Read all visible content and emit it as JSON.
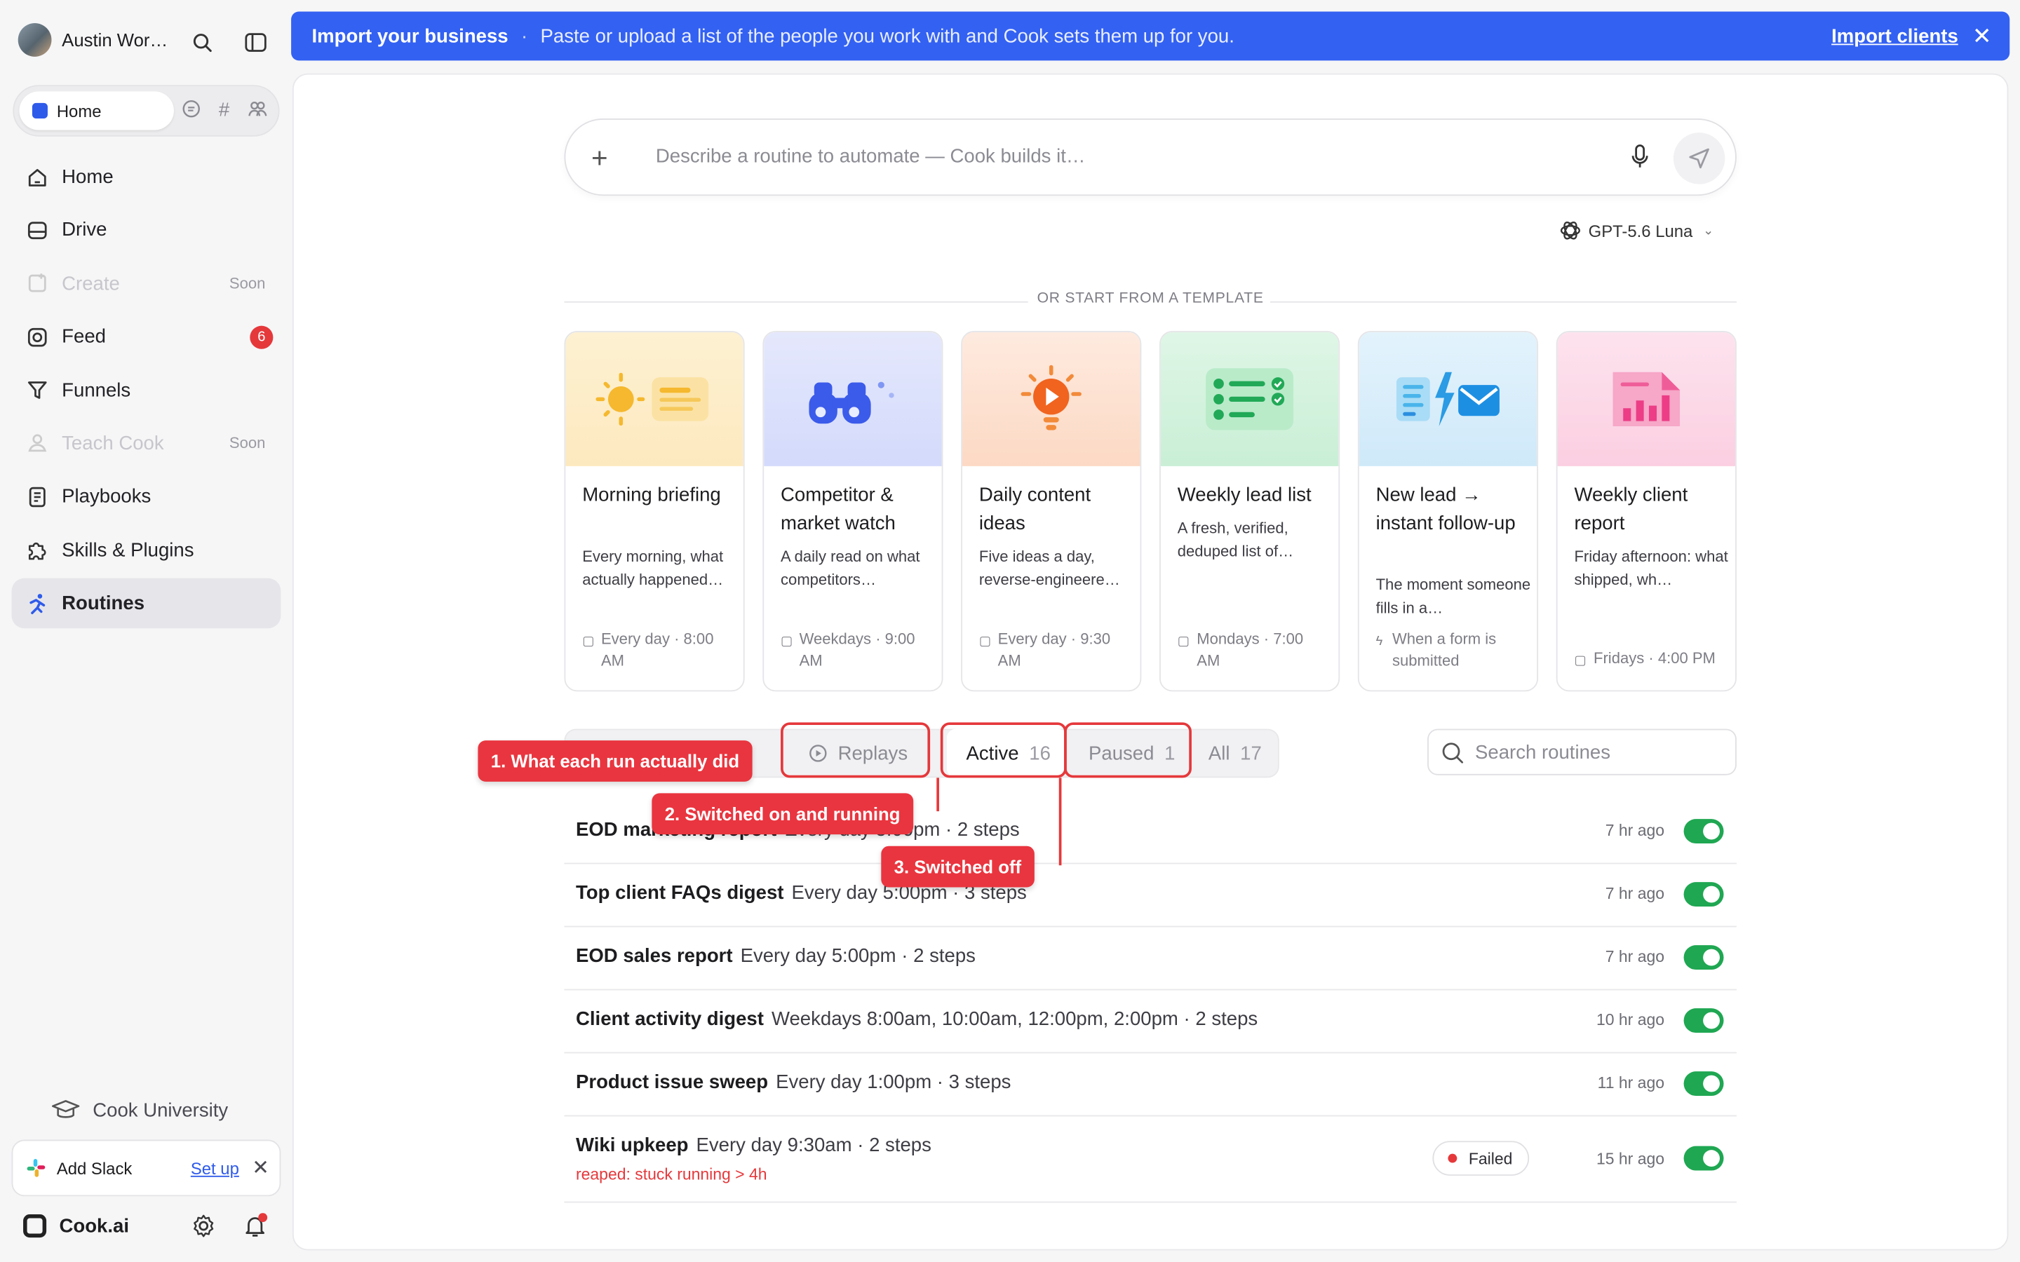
{
  "user": {
    "name": "Austin Wor…"
  },
  "sidebar": {
    "pill_home": "Home",
    "items": [
      {
        "label": "Home",
        "icon": "home-icon"
      },
      {
        "label": "Drive",
        "icon": "drive-icon"
      },
      {
        "label": "Create",
        "icon": "create-icon",
        "tag": "Soon"
      },
      {
        "label": "Feed",
        "icon": "feed-icon",
        "badge": "6"
      },
      {
        "label": "Funnels",
        "icon": "funnel-icon"
      },
      {
        "label": "Teach Cook",
        "icon": "teach-icon",
        "tag": "Soon"
      },
      {
        "label": "Playbooks",
        "icon": "playbook-icon"
      },
      {
        "label": "Skills & Plugins",
        "icon": "puzzle-icon"
      },
      {
        "label": "Routines",
        "icon": "routine-icon"
      }
    ],
    "cook_university": "Cook University",
    "slack": {
      "label": "Add Slack",
      "action": "Set up"
    },
    "brand": "Cook.ai"
  },
  "banner": {
    "title": "Import your business",
    "sep": "·",
    "description": "Paste or upload a list of the people you work with and Cook sets them up for you.",
    "cta": "Import clients"
  },
  "prompt": {
    "placeholder": "Describe a routine to automate — Cook builds it…",
    "model": "GPT-5.6 Luna"
  },
  "templates": {
    "header": "OR START FROM A TEMPLATE",
    "cards": [
      {
        "title": "Morning briefing",
        "desc": "Every morning, what actually happened…",
        "schedule": "Every day · 8:00 AM",
        "bg": "#fdf0cf"
      },
      {
        "title": "Competitor & market watch",
        "desc": "A daily read on what competitors…",
        "schedule": "Weekdays · 9:00 AM",
        "bg": "#dde2fb"
      },
      {
        "title": "Daily content ideas",
        "desc": "Five ideas a day, reverse-engineere…",
        "schedule": "Every day · 9:30 AM",
        "bg": "#fde5d6"
      },
      {
        "title": "Weekly lead list",
        "desc": "A fresh, verified, deduped list of…",
        "schedule": "Mondays · 7:00 AM",
        "bg": "#d6f3df"
      },
      {
        "title": "New lead → instant follow-up",
        "desc": "The moment someone fills in a…",
        "schedule": "When a form is submitted",
        "bg": "#dcf0fb"
      },
      {
        "title": "Weekly client report",
        "desc": "Friday afternoon: what shipped, wh…",
        "schedule": "Fridays · 4:00 PM",
        "bg": "#fcdcea"
      }
    ]
  },
  "filters": {
    "tabs": [
      {
        "label": "Replays",
        "count": ""
      },
      {
        "label": "Active",
        "count": "16"
      },
      {
        "label": "Paused",
        "count": "1"
      },
      {
        "label": "All",
        "count": "17"
      }
    ],
    "search_placeholder": "Search routines"
  },
  "routines": [
    {
      "name": "EOD marketing report",
      "meta": "Every day 5:00pm · 2 steps",
      "ago": "7 hr ago",
      "enabled": true
    },
    {
      "name": "Top client FAQs digest",
      "meta": "Every day 5:00pm · 3 steps",
      "ago": "7 hr ago",
      "enabled": true
    },
    {
      "name": "EOD sales report",
      "meta": "Every day 5:00pm · 2 steps",
      "ago": "7 hr ago",
      "enabled": true
    },
    {
      "name": "Client activity digest",
      "meta": "Weekdays 8:00am, 10:00am, 12:00pm, 2:00pm · 2 steps",
      "ago": "10 hr ago",
      "enabled": true
    },
    {
      "name": "Product issue sweep",
      "meta": "Every day 1:00pm · 3 steps",
      "ago": "11 hr ago",
      "enabled": true
    },
    {
      "name": "Wiki upkeep",
      "meta": "Every day 9:30am · 2 steps",
      "ago": "15 hr ago",
      "enabled": true,
      "status": "Failed",
      "error": "reaped: stuck running > 4h"
    }
  ],
  "annotations": {
    "a1": "1. What each run actually did",
    "a2": "2. Switched on and running",
    "a3": "3. Switched off"
  },
  "colors": {
    "accent": "#3361f2",
    "success": "#1fa752",
    "danger": "#e5383b"
  }
}
